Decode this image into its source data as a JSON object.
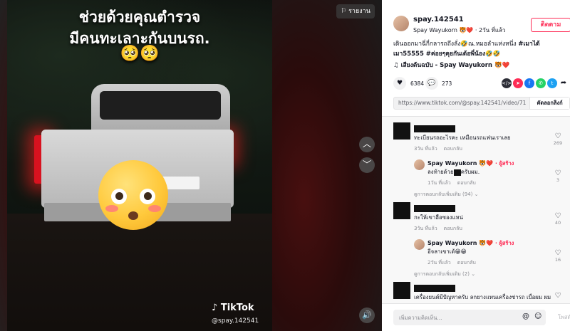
{
  "video": {
    "overlay_line1": "ช่วยด้วยคุณตำรวจ",
    "overlay_line2": "มีคนทะเลาะกันบนรถ.",
    "overlay_emoji": "🥺🥺",
    "watermark": "TikTok",
    "watermark_handle": "@spay.142541",
    "report_label": "รายงาน"
  },
  "post": {
    "username": "spay.142541",
    "display_name": "Spay Wayukorn 🐯❤️",
    "time_ago": "· 2วัน ที่แล้ว",
    "follow_label": "ติดตาม",
    "caption": "เดินออกมาฉี่กี่กลารถถึงลั่ง🤣ณ.หมอลำแห่งหนึ่ง",
    "hashtags": "#เมาได้เมา55555 #ค่อยๆคุยกันเด้อพี่น้อง🤣🤣",
    "music": "♫  เสียงต้นฉบับ - Spay Wayukorn 🐯❤️",
    "likes": "6384",
    "comments_count": "273",
    "url": "https://www.tiktok.com/@spay.142541/video/7119144989...",
    "copy_label": "คัดลอกลิงก์"
  },
  "comments": [
    {
      "text": "ทะเบียนรถอะไรคะ เหมือนรถแฟนเราเลย",
      "meta_time": "3วัน ที่แล้ว",
      "meta_reply": "ตอบกลับ",
      "likes": "269",
      "reply": {
        "name": "Spay Wayukorn 🐯❤️",
        "creator": "· ผู้สร้าง",
        "text_pre": "ลงท้ายด้วย",
        "text_post": "ครับผม.",
        "meta_time": "1วัน ที่แล้ว",
        "meta_reply": "ตอบกลับ",
        "likes": "3"
      },
      "more": "ดูการตอบกลับเพิ่มเติม (94)"
    },
    {
      "text": "กะให้เขาฮือซองแหน่",
      "meta_time": "3วัน ที่แล้ว",
      "meta_reply": "ตอบกลับ",
      "likes": "40",
      "reply": {
        "name": "Spay Wayukorn 🐯❤️",
        "creator": "· ผู้สร้าง",
        "text": "อีจลาเขาเด้😁😁",
        "meta_time": "2วัน ที่แล้ว",
        "meta_reply": "ตอบกลับ",
        "likes": "16"
      },
      "more": "ดูการตอบกลับเพิ่มเติม (2)"
    },
    {
      "text": "เครื่องยนต์มีปัญหาครับ ลกยางแทนเครื่องซ่ารถ เบื่อผม ผม"
    }
  ],
  "compose": {
    "placeholder": "เพิ่มความคิดเห็น...",
    "post_label": "โพสต์"
  }
}
